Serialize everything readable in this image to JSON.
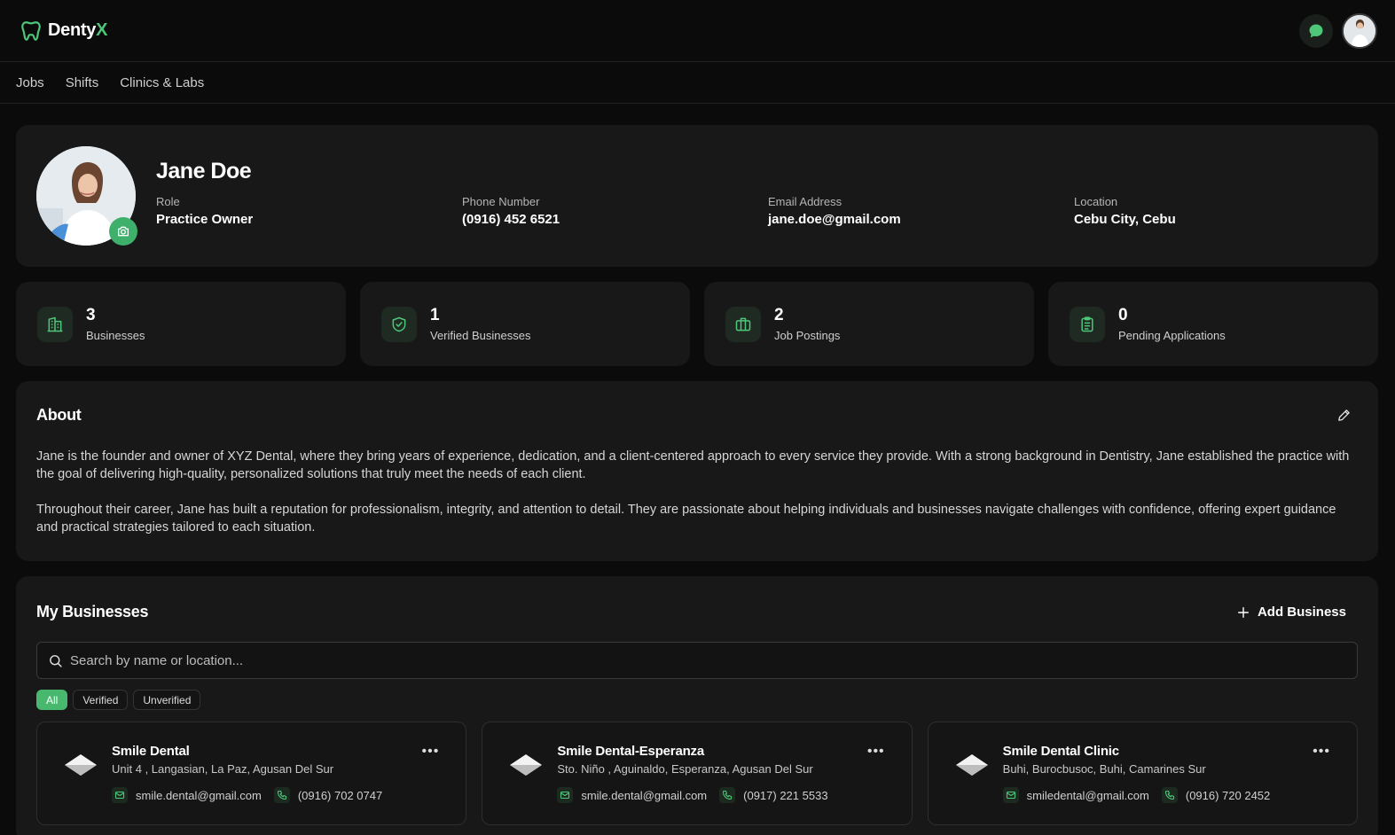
{
  "brand": {
    "name_main": "Denty",
    "name_accent": "X",
    "accent_color": "#4ec77a"
  },
  "nav": {
    "items": [
      "Jobs",
      "Shifts",
      "Clinics & Labs"
    ]
  },
  "profile": {
    "name": "Jane Doe",
    "role_label": "Role",
    "role": "Practice Owner",
    "phone_label": "Phone Number",
    "phone": "(0916) 452 6521",
    "email_label": "Email Address",
    "email": "jane.doe@gmail.com",
    "location_label": "Location",
    "location": "Cebu City, Cebu"
  },
  "stats": [
    {
      "value": "3",
      "label": "Businesses",
      "icon": "building-icon"
    },
    {
      "value": "1",
      "label": "Verified Businesses",
      "icon": "shield-check-icon"
    },
    {
      "value": "2",
      "label": "Job Postings",
      "icon": "briefcase-icon"
    },
    {
      "value": "0",
      "label": "Pending Applications",
      "icon": "clipboard-icon"
    }
  ],
  "about": {
    "title": "About",
    "paragraphs": [
      "Jane is the founder and owner of XYZ Dental, where they bring years of experience, dedication, and a client-centered approach to every service they provide. With a strong background in Dentistry, Jane established the practice with the goal of delivering high-quality, personalized solutions that truly meet the needs of each client.",
      "Throughout their career, Jane has built a reputation for professionalism, integrity, and attention to detail. They are passionate about helping individuals and businesses navigate challenges with confidence, offering expert guidance and practical strategies tailored to each situation."
    ]
  },
  "businesses": {
    "title": "My Businesses",
    "add_label": "Add Business",
    "search_placeholder": "Search by name or location...",
    "filters": [
      "All",
      "Verified",
      "Unverified"
    ],
    "active_filter": "All",
    "more_label": "•••",
    "items": [
      {
        "name": "Smile Dental",
        "address": "Unit 4 , Langasian, La Paz, Agusan Del Sur",
        "email": "smile.dental@gmail.com",
        "phone": "(0916) 702 0747"
      },
      {
        "name": "Smile Dental-Esperanza",
        "address": "Sto. Niño , Aguinaldo, Esperanza, Agusan Del Sur",
        "email": "smile.dental@gmail.com",
        "phone": "(0917) 221 5533"
      },
      {
        "name": "Smile Dental Clinic",
        "address": "Buhi, Burocbusoc, Buhi, Camarines Sur",
        "email": "smiledental@gmail.com",
        "phone": "(0916) 720 2452"
      }
    ]
  }
}
